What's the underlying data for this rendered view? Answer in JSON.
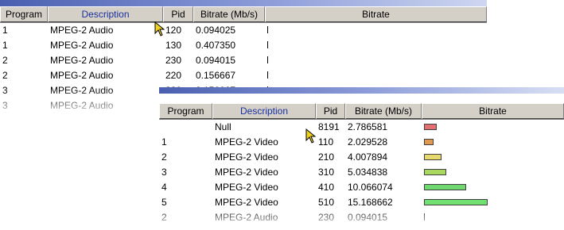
{
  "back_table": {
    "columns": [
      "Program",
      "Description",
      "Pid",
      "Bitrate (Mb/s)",
      "Bitrate"
    ],
    "rows": [
      {
        "program": "1",
        "description": "MPEG-2 Audio",
        "pid": "120",
        "bitrate": "0.094025"
      },
      {
        "program": "1",
        "description": "MPEG-2 Audio",
        "pid": "130",
        "bitrate": "0.407350"
      },
      {
        "program": "2",
        "description": "MPEG-2 Audio",
        "pid": "230",
        "bitrate": "0.094015"
      },
      {
        "program": "2",
        "description": "MPEG-2 Audio",
        "pid": "220",
        "bitrate": "0.156667"
      },
      {
        "program": "3",
        "description": "MPEG-2 Audio",
        "pid": "320",
        "bitrate": "0.156667"
      },
      {
        "program": "3",
        "description": "MPEG-2 Audio",
        "pid": "",
        "bitrate": ""
      }
    ]
  },
  "front_table": {
    "columns": [
      "Program",
      "Description",
      "Pid",
      "Bitrate (Mb/s)",
      "Bitrate"
    ],
    "rows": [
      {
        "program": "",
        "description": "Null",
        "pid": "8191",
        "bitrate": "2.786581",
        "bar_fraction": 0.18,
        "bar_color": "#e07070"
      },
      {
        "program": "1",
        "description": "MPEG-2 Video",
        "pid": "110",
        "bitrate": "2.029528",
        "bar_fraction": 0.13,
        "bar_color": "#e09a50"
      },
      {
        "program": "2",
        "description": "MPEG-2 Video",
        "pid": "210",
        "bitrate": "4.007894",
        "bar_fraction": 0.26,
        "bar_color": "#e8d870"
      },
      {
        "program": "3",
        "description": "MPEG-2 Video",
        "pid": "310",
        "bitrate": "5.034838",
        "bar_fraction": 0.33,
        "bar_color": "#a8d860"
      },
      {
        "program": "4",
        "description": "MPEG-2 Video",
        "pid": "410",
        "bitrate": "10.066074",
        "bar_fraction": 0.66,
        "bar_color": "#70d870"
      },
      {
        "program": "5",
        "description": "MPEG-2 Video",
        "pid": "510",
        "bitrate": "15.168662",
        "bar_fraction": 1.0,
        "bar_color": "#70e070"
      },
      {
        "program": "2",
        "description": "MPEG-2 Audio",
        "pid": "230",
        "bitrate": "0.094015",
        "bar_fraction": 0,
        "bar_color": ""
      }
    ]
  },
  "icons": {
    "cursor": "arrow-cursor-icon"
  },
  "colors": {
    "header_bg": "#d4d0c8",
    "description_header": "#1a2fa0",
    "title_bar": "#4a5fb0"
  }
}
